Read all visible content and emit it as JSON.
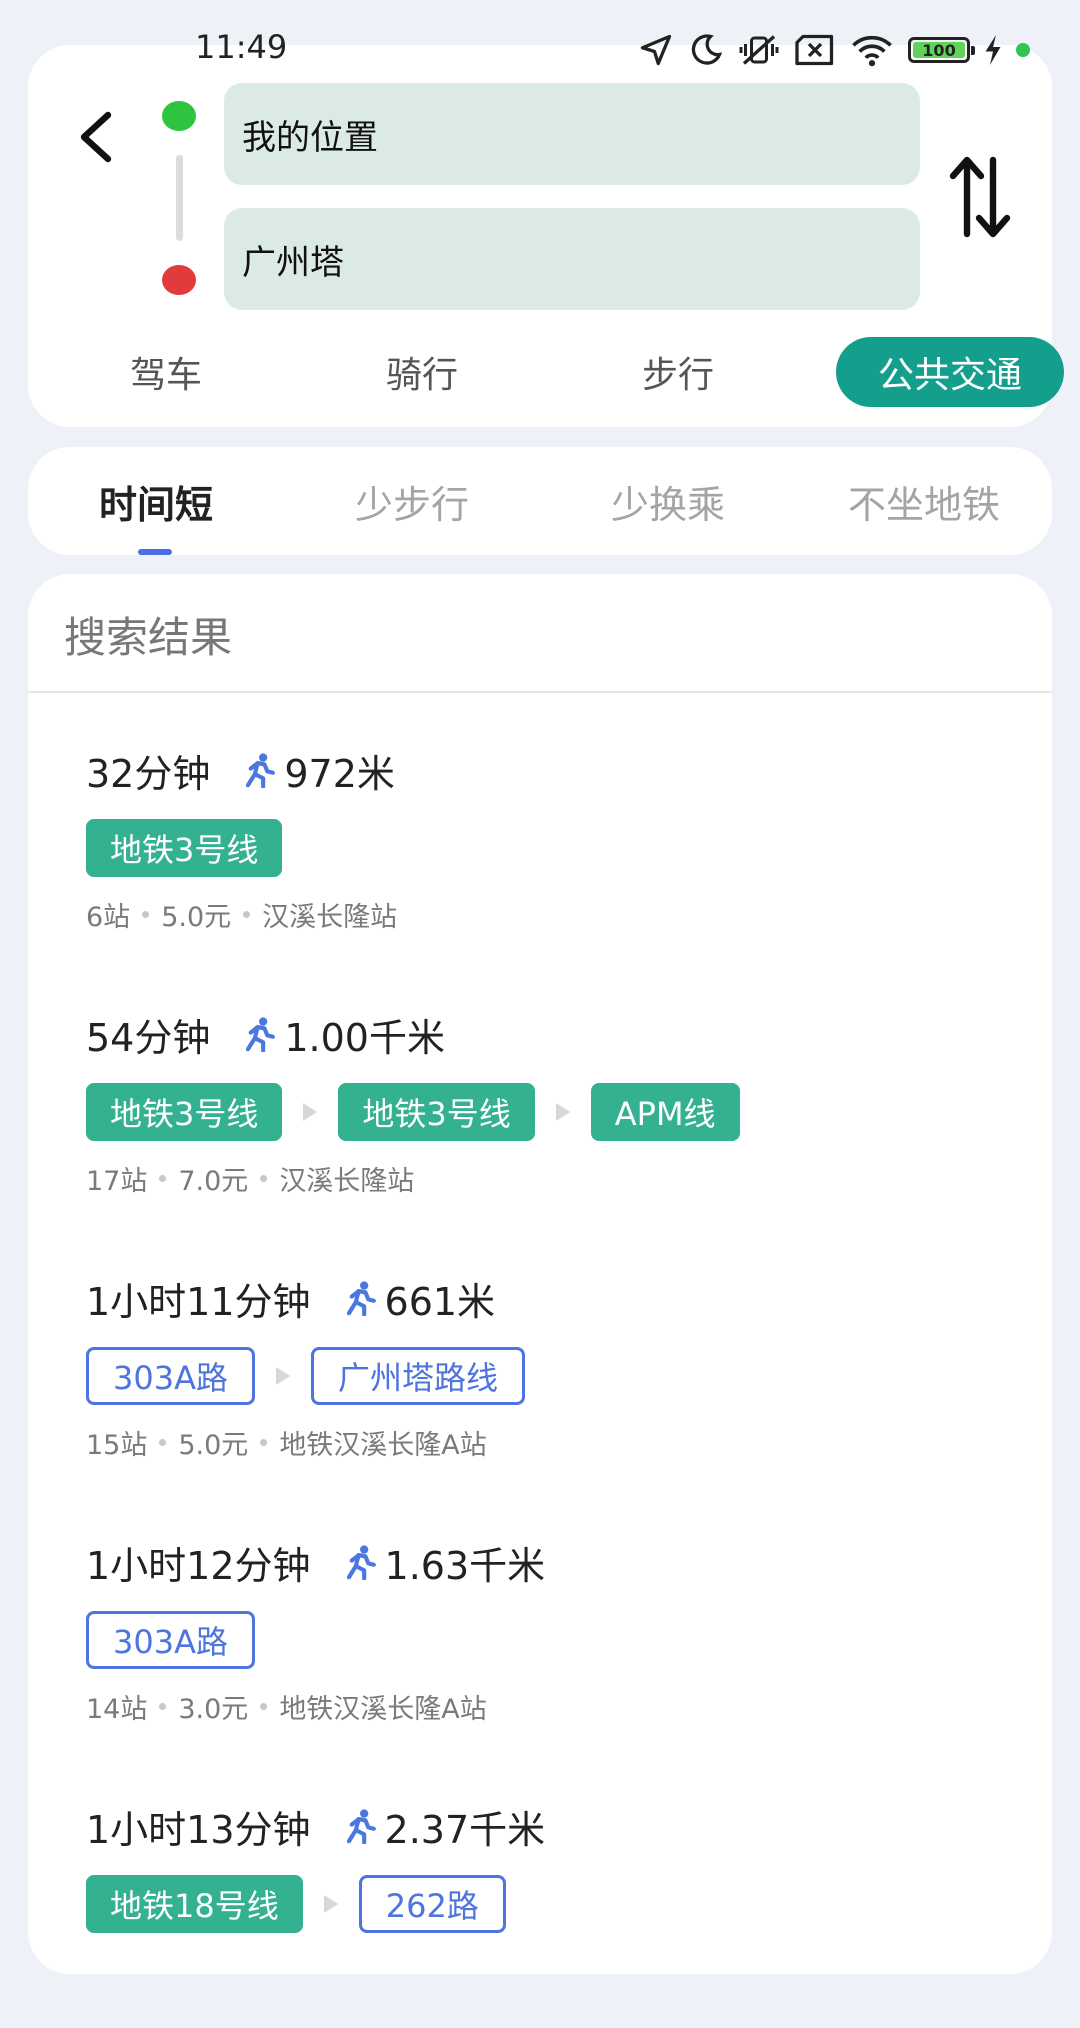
{
  "status_bar": {
    "time": "11:49",
    "battery": "100"
  },
  "locations": {
    "start": "我的位置",
    "end": "广州塔"
  },
  "mode_tabs": [
    "驾车",
    "骑行",
    "步行",
    "公共交通"
  ],
  "mode_active_index": 3,
  "filter_tabs": [
    "时间短",
    "少步行",
    "少换乘",
    "不坐地铁"
  ],
  "filter_active_index": 0,
  "results_title": "搜索结果",
  "routes": [
    {
      "time": "32分钟",
      "walk": "972米",
      "lines": [
        {
          "label": "地铁3号线",
          "type": "subway"
        }
      ],
      "stops": "6站",
      "fare": "5.0元",
      "station": "汉溪长隆站"
    },
    {
      "time": "54分钟",
      "walk": "1.00千米",
      "lines": [
        {
          "label": "地铁3号线",
          "type": "subway"
        },
        {
          "label": "地铁3号线",
          "type": "subway"
        },
        {
          "label": "APM线",
          "type": "subway"
        }
      ],
      "stops": "17站",
      "fare": "7.0元",
      "station": "汉溪长隆站"
    },
    {
      "time": "1小时11分钟",
      "walk": "661米",
      "lines": [
        {
          "label": "303A路",
          "type": "bus"
        },
        {
          "label": "广州塔路线",
          "type": "bus"
        }
      ],
      "stops": "15站",
      "fare": "5.0元",
      "station": "地铁汉溪长隆A站"
    },
    {
      "time": "1小时12分钟",
      "walk": "1.63千米",
      "lines": [
        {
          "label": "303A路",
          "type": "bus"
        }
      ],
      "stops": "14站",
      "fare": "3.0元",
      "station": "地铁汉溪长隆A站"
    },
    {
      "time": "1小时13分钟",
      "walk": "2.37千米",
      "lines": [
        {
          "label": "地铁18号线",
          "type": "subway"
        },
        {
          "label": "262路",
          "type": "bus"
        }
      ],
      "stops": "",
      "fare": "",
      "station": ""
    }
  ],
  "colors": {
    "accent_teal": "#139f8b",
    "subway_tag": "#33b191",
    "bus_tag_border": "#4d74df",
    "start_dot": "#2ec440",
    "end_dot": "#e23b3b"
  }
}
